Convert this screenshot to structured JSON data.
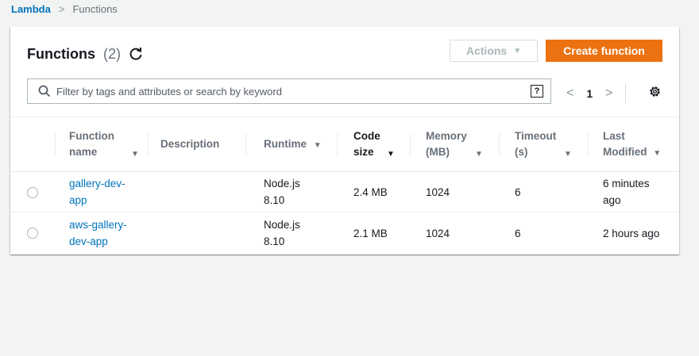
{
  "breadcrumb": {
    "root": "Lambda",
    "separator": ">",
    "current": "Functions"
  },
  "panel": {
    "title": "Functions",
    "count": "(2)",
    "actions_label": "Actions",
    "create_label": "Create function"
  },
  "search": {
    "placeholder": "Filter by tags and attributes or search by keyword",
    "help": "?"
  },
  "pager": {
    "prev": "<",
    "page": "1",
    "next": ">"
  },
  "columns": {
    "name": [
      "Function",
      "name"
    ],
    "description": "Description",
    "runtime": "Runtime",
    "code_size": [
      "Code",
      "size"
    ],
    "memory": [
      "Memory",
      "(MB)"
    ],
    "timeout": [
      "Timeout",
      "(s)"
    ],
    "last_modified": [
      "Last",
      "Modified"
    ]
  },
  "rows": [
    {
      "name": [
        "gallery-dev-",
        "app"
      ],
      "description": "",
      "runtime": [
        "Node.js",
        "8.10"
      ],
      "code_size": "2.4 MB",
      "memory": "1024",
      "timeout": "6",
      "last_modified": [
        "6 minutes",
        "ago"
      ]
    },
    {
      "name": [
        "aws-gallery-",
        "dev-app"
      ],
      "description": "",
      "runtime": [
        "Node.js",
        "8.10"
      ],
      "code_size": "2.1 MB",
      "memory": "1024",
      "timeout": "6",
      "last_modified": [
        "2 hours ago"
      ]
    }
  ],
  "colors": {
    "accent": "#ec7211",
    "link": "#0073bb",
    "muted": "#687078"
  }
}
